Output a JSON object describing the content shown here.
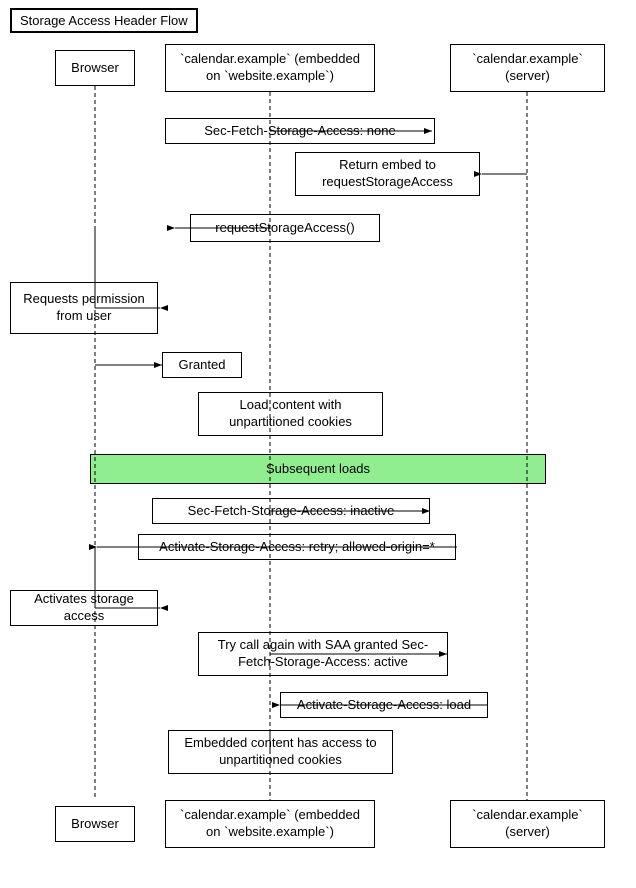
{
  "title": "Storage Access Header Flow",
  "boxes": {
    "title": "Storage Access Header Flow",
    "browser_top": "Browser",
    "calendar_embedded_top": "`calendar.example`\n(embedded on `website.example`)",
    "calendar_server_top": "`calendar.example`\n(server)",
    "sec_fetch_none": "Sec-Fetch-Storage-Access: none",
    "return_embed": "Return embed to\nrequestStorageAccess",
    "request_storage_access": "requestStorageAccess()",
    "requests_permission": "Requests permission\nfrom user",
    "granted": "Granted",
    "load_content": "Load content with\nunpartitioned cookies",
    "subsequent_loads": "Subsequent loads",
    "sec_fetch_inactive": "Sec-Fetch-Storage-Access: inactive",
    "activate_retry": "Activate-Storage-Access: retry; allowed-origin=*",
    "activates_storage": "Activates storage access",
    "try_call_again": "Try call again with SAA granted\nSec-Fetch-Storage-Access: active",
    "activate_load": "Activate-Storage-Access: load",
    "embedded_content": "Embedded content has\naccess to unpartitioned cookies",
    "browser_bottom": "Browser",
    "calendar_embedded_bottom": "`calendar.example`\n(embedded on `website.example`)",
    "calendar_server_bottom": "`calendar.example`\n(server)"
  }
}
